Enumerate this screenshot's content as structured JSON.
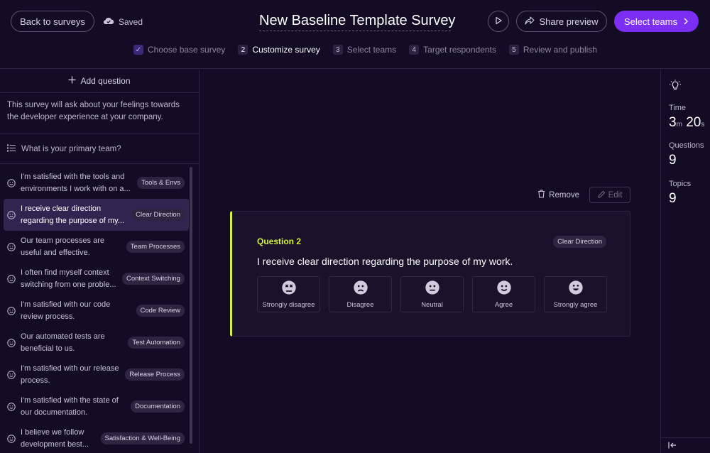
{
  "header": {
    "back_label": "Back to surveys",
    "saved_label": "Saved",
    "title": "New Baseline Template Survey",
    "share_label": "Share preview",
    "select_teams_label": "Select teams"
  },
  "steps": [
    {
      "num": "",
      "label": "Choose base survey",
      "state": "done"
    },
    {
      "num": "2",
      "label": "Customize survey",
      "state": "active"
    },
    {
      "num": "3",
      "label": "Select teams",
      "state": "pending"
    },
    {
      "num": "4",
      "label": "Target respondents",
      "state": "pending"
    },
    {
      "num": "5",
      "label": "Review and publish",
      "state": "pending"
    }
  ],
  "sidebar": {
    "add_question_label": "Add question",
    "intro": "This survey will ask about your feelings towards the developer experience at your company.",
    "primary_team_label": "What is your primary team?",
    "questions": [
      {
        "text": "I'm satisfied with the tools and environments I work with on a...",
        "tag": "Tools & Envs"
      },
      {
        "text": "I receive clear direction regarding the purpose of my...",
        "tag": "Clear Direction"
      },
      {
        "text": "Our team processes are useful and effective.",
        "tag": "Team Processes"
      },
      {
        "text": "I often find myself context switching from one proble...",
        "tag": "Context Switching"
      },
      {
        "text": "I'm satisfied with our code review process.",
        "tag": "Code Review"
      },
      {
        "text": "Our automated tests are beneficial to us.",
        "tag": "Test Automation"
      },
      {
        "text": "I'm satisfied with our release process.",
        "tag": "Release Process"
      },
      {
        "text": "I'm satisfied with the state of our documentation.",
        "tag": "Documentation"
      },
      {
        "text": "I believe we follow development best...",
        "tag": "Satisfaction & Well-Being"
      }
    ]
  },
  "main": {
    "remove_label": "Remove",
    "edit_label": "Edit",
    "card": {
      "number_label": "Question 2",
      "tag": "Clear Direction",
      "question": "I receive clear direction regarding the purpose of my work.",
      "options": [
        "Strongly disagree",
        "Disagree",
        "Neutral",
        "Agree",
        "Strongly agree"
      ]
    }
  },
  "stats": {
    "time_label": "Time",
    "time_minutes": "3",
    "time_minutes_unit": "m",
    "time_seconds": "20",
    "time_seconds_unit": "s",
    "questions_label": "Questions",
    "questions_value": "9",
    "topics_label": "Topics",
    "topics_value": "9"
  },
  "colors": {
    "accent": "#7c2ff2",
    "highlight": "#d7f23a",
    "background": "#120d24"
  }
}
